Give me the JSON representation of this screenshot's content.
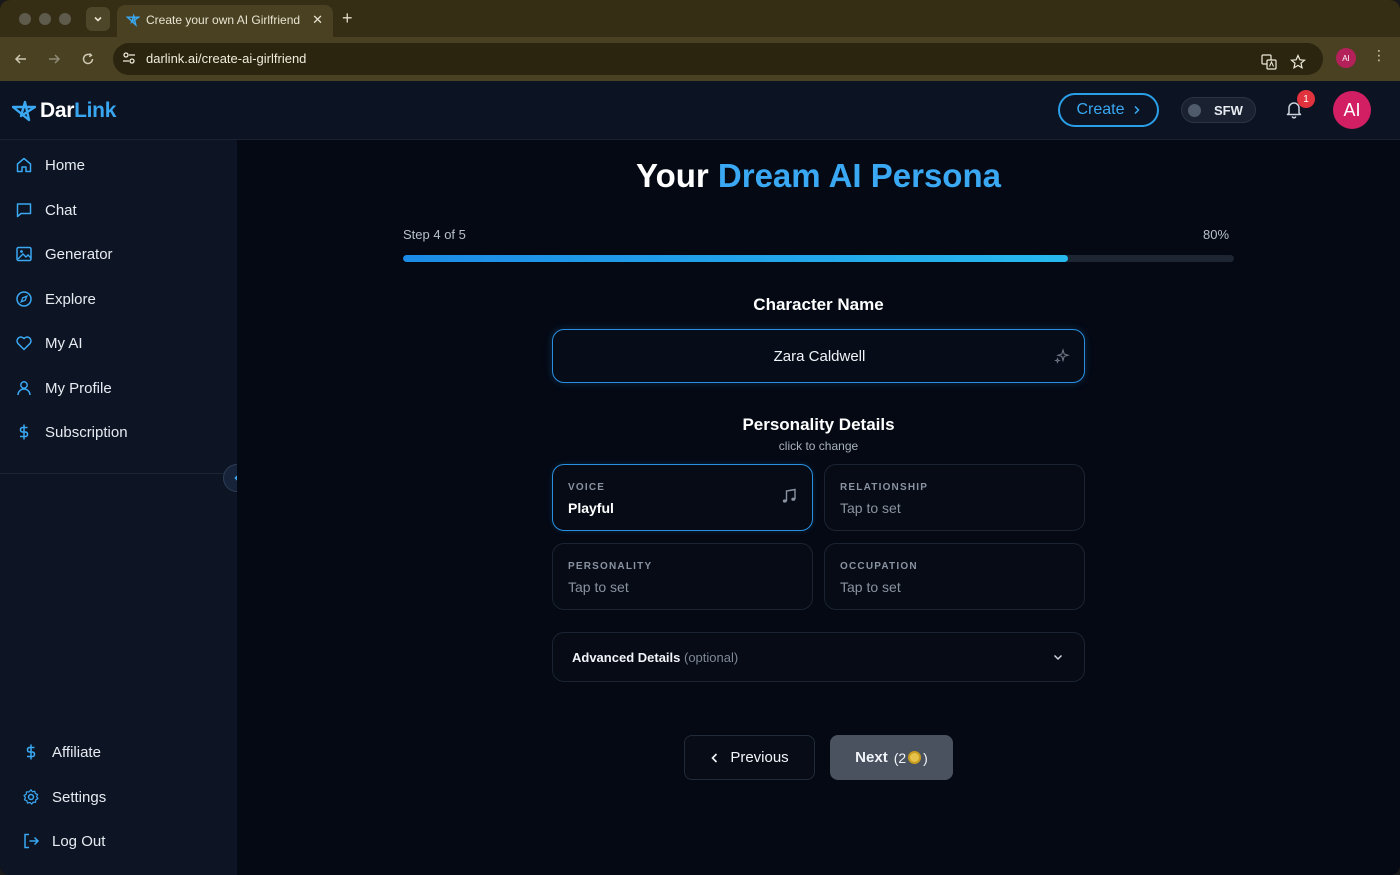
{
  "browser": {
    "tab_title": "Create your own AI Girlfriend",
    "url": "darlink.ai/create-ai-girlfriend",
    "profile_initials": "AI"
  },
  "header": {
    "logo_dar": "Dar",
    "logo_link": "Link",
    "create_label": "Create",
    "sfw_label": "SFW",
    "notification_count": "1",
    "avatar_initials": "AI",
    "accent_color": "#3aa8f2"
  },
  "sidebar": {
    "items": [
      {
        "label": "Home",
        "icon": "home-icon"
      },
      {
        "label": "Chat",
        "icon": "chat-icon"
      },
      {
        "label": "Generator",
        "icon": "image-icon"
      },
      {
        "label": "Explore",
        "icon": "compass-icon"
      },
      {
        "label": "My AI",
        "icon": "heart-icon"
      },
      {
        "label": "My Profile",
        "icon": "user-icon"
      },
      {
        "label": "Subscription",
        "icon": "dollar-icon"
      }
    ],
    "bottom_items": [
      {
        "label": "Affiliate",
        "icon": "dollar-icon"
      },
      {
        "label": "Settings",
        "icon": "gear-icon"
      },
      {
        "label": "Log Out",
        "icon": "logout-icon"
      }
    ]
  },
  "main": {
    "title_prefix": "Your ",
    "title_accent": "Dream AI Persona",
    "step_label": "Step 4 of 5",
    "progress_label": "80%",
    "progress_value": 0.8,
    "name_section_title": "Character Name",
    "name_value": "Zara Caldwell",
    "personality_title": "Personality Details",
    "personality_subtitle": "click to change",
    "cards": [
      {
        "caption": "VOICE",
        "value": "Playful"
      },
      {
        "caption": "RELATIONSHIP",
        "value": "Tap to set"
      },
      {
        "caption": "PERSONALITY",
        "value": "Tap to set"
      },
      {
        "caption": "OCCUPATION",
        "value": "Tap to set"
      }
    ],
    "advanced_label": "Advanced Details",
    "advanced_optional": "(optional)",
    "previous_label": "Previous",
    "next_label": "Next",
    "next_cost_open": "(2",
    "next_cost_close": ")"
  }
}
